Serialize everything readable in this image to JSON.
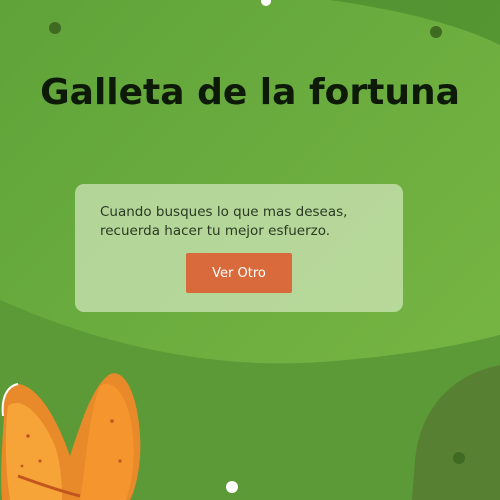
{
  "title": "Galleta de la fortuna",
  "fortune": {
    "message": "Cuando busques lo que mas deseas, recuerda hacer tu mejor esfuerzo.",
    "button_label": "Ver Otro"
  },
  "colors": {
    "background": "#6aab3f",
    "accent_button": "#d96a3c",
    "title": "#0d1a08"
  },
  "icons": [
    "fortune-cookie-icon"
  ]
}
